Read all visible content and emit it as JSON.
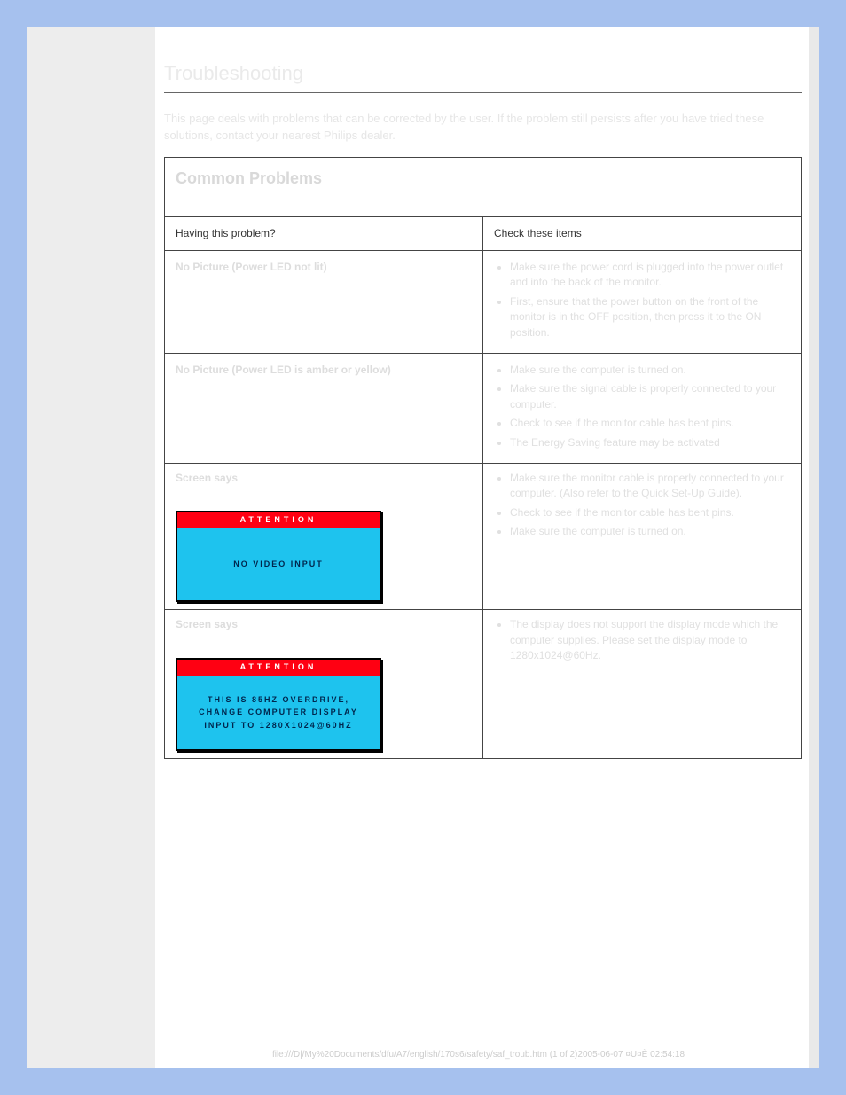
{
  "heading": "Troubleshooting",
  "intro": "This page deals with problems that can be corrected by the user. If the problem still persists after you have tried these solutions, contact your nearest Philips dealer.",
  "table": {
    "caption": "Common Problems",
    "col_a": "Having this problem?",
    "col_b": "Check these items",
    "rows": [
      {
        "q": "No Picture (Power LED not lit)",
        "a": [
          "Make sure the power cord is plugged into the power outlet and into the back of the monitor.",
          "First, ensure that the power button on the front of the monitor is in the OFF position, then press it to the ON position."
        ]
      },
      {
        "q": "No Picture (Power LED is amber or yellow)",
        "a": [
          "Make sure the computer is turned on.",
          "Make sure the signal cable is properly connected to your computer.",
          "Check to see if the monitor cable has bent pins.",
          "The Energy Saving feature may be activated"
        ]
      },
      {
        "q": "Screen says",
        "a": [
          "Make sure the monitor cable is properly connected to your computer. (Also refer to the Quick Set-Up Guide).",
          "Check to see if the monitor cable has bent pins.",
          "Make sure the computer is turned on."
        ],
        "media": {
          "bar": "ATTENTION",
          "body": "NO VIDEO INPUT"
        }
      },
      {
        "q": "Screen says",
        "a": [
          "The display does not support the display mode which the computer supplies. Please set the display mode to 1280x1024@60Hz."
        ],
        "media": {
          "bar": "ATTENTION",
          "body": "THIS IS 85HZ OVERDRIVE, CHANGE COMPUTER DISPLAY INPUT TO 1280X1024@60HZ"
        }
      }
    ]
  },
  "pager": "file:///D|/My%20Documents/dfu/A7/english/170s6/safety/saf_troub.htm (1 of 2)2005-06-07 ¤U¤È 02:54:18"
}
